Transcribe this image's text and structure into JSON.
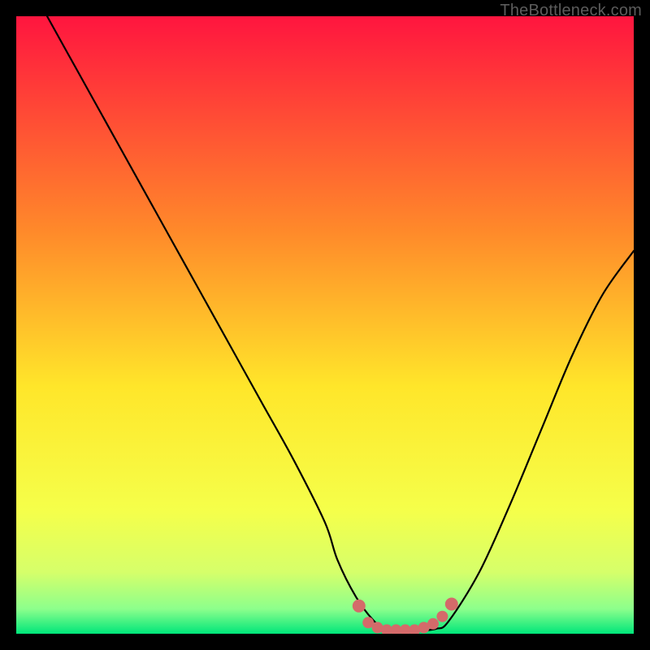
{
  "watermark": "TheBottleneck.com",
  "colors": {
    "frame": "#000000",
    "gradient_top": "#ff153f",
    "gradient_mid_upper": "#ff8a2a",
    "gradient_mid": "#ffe62a",
    "gradient_mid_lower": "#f5ff4a",
    "gradient_low1": "#d6ff6a",
    "gradient_low2": "#8cff8c",
    "gradient_bottom": "#00e67a",
    "curve": "#000000",
    "marker_fill": "#d46a6a",
    "marker_stroke": "#d46a6a"
  },
  "chart_data": {
    "type": "line",
    "title": "",
    "xlabel": "",
    "ylabel": "",
    "xlim": [
      0,
      100
    ],
    "ylim": [
      0,
      100
    ],
    "series": [
      {
        "name": "bottleneck-curve",
        "x": [
          5,
          10,
          15,
          20,
          25,
          30,
          35,
          40,
          45,
          50,
          52,
          55,
          58,
          60,
          62,
          65,
          68,
          70,
          75,
          80,
          85,
          90,
          95,
          100
        ],
        "y": [
          100,
          91,
          82,
          73,
          64,
          55,
          46,
          37,
          28,
          18,
          12,
          6,
          2,
          0.8,
          0.5,
          0.5,
          0.8,
          2,
          10,
          21,
          33,
          45,
          55,
          62
        ]
      }
    ],
    "markers": {
      "name": "optimal-range",
      "x": [
        55.5,
        57,
        58.5,
        60,
        61.5,
        63,
        64.5,
        66,
        67.5,
        69,
        70.5
      ],
      "y": [
        4.5,
        1.8,
        1.0,
        0.6,
        0.6,
        0.6,
        0.6,
        1.0,
        1.6,
        2.8,
        4.8
      ]
    },
    "annotations": []
  }
}
